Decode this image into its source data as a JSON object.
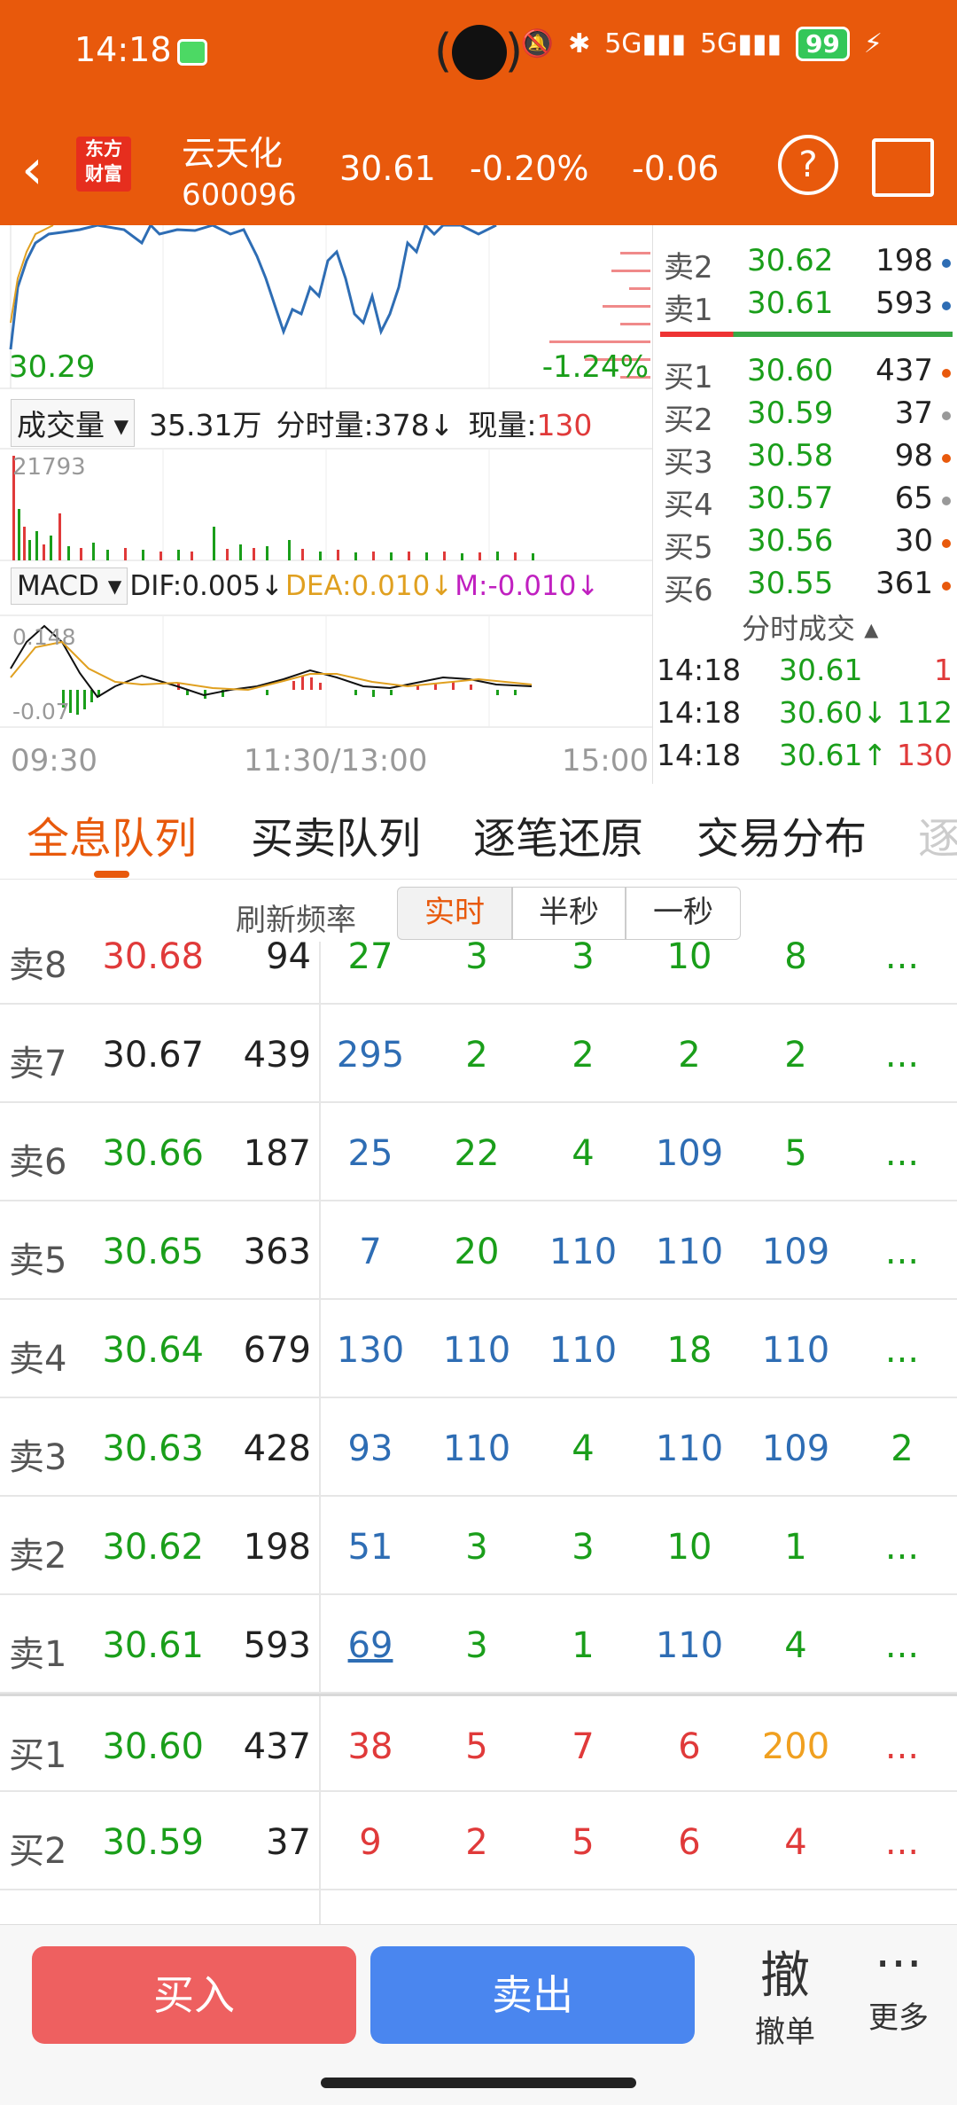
{
  "status_bar": {
    "time": "14:18",
    "signal_5g_a": "5G",
    "signal_5g_b": "5G",
    "battery": "99"
  },
  "header": {
    "back_icon": "chevron-left-icon",
    "logo_text": "东方财富",
    "stock_name": "云天化",
    "stock_code": "600096",
    "price": "30.61",
    "change_pct": "-0.20%",
    "change": "-0.06",
    "help_icon": "question-icon"
  },
  "chart": {
    "low_price": "30.29",
    "low_pct": "-1.24%",
    "volume_selector": "成交量",
    "volume_total": "35.31万",
    "volume_per_min": "分时量:378↓",
    "current_volume_label": "现量:",
    "current_volume": "130",
    "volume_max": "21793",
    "macd_selector": "MACD",
    "dif": "DIF:0.005↓",
    "dea": "DEA:0.010↓",
    "m": "M:-0.010↓",
    "macd_top": "0.148",
    "macd_bottom": "-0.07",
    "time_start": "09:30",
    "time_mid": "11:30/13:00",
    "time_end": "15:00"
  },
  "order_book": {
    "asks": [
      {
        "label": "卖2",
        "price": "30.62",
        "qty": "198",
        "dot": "#2e6db4"
      },
      {
        "label": "卖1",
        "price": "30.61",
        "qty": "593",
        "dot": "#2e6db4"
      }
    ],
    "bids": [
      {
        "label": "买1",
        "price": "30.60",
        "qty": "437",
        "dot": "#e8590c"
      },
      {
        "label": "买2",
        "price": "30.59",
        "qty": "37",
        "dot": "#999999"
      },
      {
        "label": "买3",
        "price": "30.58",
        "qty": "98",
        "dot": "#e8590c"
      },
      {
        "label": "买4",
        "price": "30.57",
        "qty": "65",
        "dot": "#999999"
      },
      {
        "label": "买5",
        "price": "30.56",
        "qty": "30",
        "dot": "#e8590c"
      },
      {
        "label": "买6",
        "price": "30.55",
        "qty": "361",
        "dot": "#e8590c"
      }
    ],
    "trades_title": "分时成交",
    "trades": [
      {
        "time": "14:18",
        "price": "30.61",
        "vol": "1",
        "color": "#e03a3a"
      },
      {
        "time": "14:18",
        "price": "30.60↓",
        "vol": "112",
        "color": "#1a9e1a"
      },
      {
        "time": "14:18",
        "price": "30.61↑",
        "vol": "130",
        "color": "#e03a3a"
      }
    ]
  },
  "tabs": [
    {
      "label": "全息队列",
      "active": true
    },
    {
      "label": "买卖队列",
      "active": false
    },
    {
      "label": "逐笔还原",
      "active": false
    },
    {
      "label": "交易分布",
      "active": false
    },
    {
      "label": "逐",
      "active": false
    }
  ],
  "refresh": {
    "label": "刷新频率",
    "options": [
      "实时",
      "半秒",
      "一秒"
    ],
    "selected": "实时"
  },
  "queue": {
    "rows": [
      {
        "label": "卖8",
        "price": "30.68",
        "price_color": "red",
        "qty": "94",
        "cells": [
          [
            "27",
            "green"
          ],
          [
            "3",
            "green"
          ],
          [
            "3",
            "green"
          ],
          [
            "10",
            "green"
          ],
          [
            "8",
            "green"
          ],
          [
            "...",
            "green"
          ]
        ]
      },
      {
        "label": "卖7",
        "price": "30.67",
        "price_color": "black",
        "qty": "439",
        "cells": [
          [
            "295",
            "blue"
          ],
          [
            "2",
            "green"
          ],
          [
            "2",
            "green"
          ],
          [
            "2",
            "green"
          ],
          [
            "2",
            "green"
          ],
          [
            "...",
            "green"
          ]
        ]
      },
      {
        "label": "卖6",
        "price": "30.66",
        "price_color": "green",
        "qty": "187",
        "cells": [
          [
            "25",
            "blue"
          ],
          [
            "22",
            "green"
          ],
          [
            "4",
            "green"
          ],
          [
            "109",
            "blue"
          ],
          [
            "5",
            "green"
          ],
          [
            "...",
            "green"
          ]
        ]
      },
      {
        "label": "卖5",
        "price": "30.65",
        "price_color": "green",
        "qty": "363",
        "cells": [
          [
            "7",
            "blue"
          ],
          [
            "20",
            "green"
          ],
          [
            "110",
            "blue"
          ],
          [
            "110",
            "blue"
          ],
          [
            "109",
            "blue"
          ],
          [
            "...",
            "green"
          ]
        ]
      },
      {
        "label": "卖4",
        "price": "30.64",
        "price_color": "green",
        "qty": "679",
        "cells": [
          [
            "130",
            "blue"
          ],
          [
            "110",
            "blue"
          ],
          [
            "110",
            "blue"
          ],
          [
            "18",
            "green"
          ],
          [
            "110",
            "blue"
          ],
          [
            "...",
            "green"
          ]
        ]
      },
      {
        "label": "卖3",
        "price": "30.63",
        "price_color": "green",
        "qty": "428",
        "cells": [
          [
            "93",
            "blue"
          ],
          [
            "110",
            "blue"
          ],
          [
            "4",
            "green"
          ],
          [
            "110",
            "blue"
          ],
          [
            "109",
            "blue"
          ],
          [
            "2",
            "green"
          ]
        ]
      },
      {
        "label": "卖2",
        "price": "30.62",
        "price_color": "green",
        "qty": "198",
        "cells": [
          [
            "51",
            "blue"
          ],
          [
            "3",
            "green"
          ],
          [
            "3",
            "green"
          ],
          [
            "10",
            "green"
          ],
          [
            "1",
            "green"
          ],
          [
            "...",
            "green"
          ]
        ]
      },
      {
        "label": "卖1",
        "price": "30.61",
        "price_color": "green",
        "qty": "593",
        "cells": [
          [
            "69",
            "blue under"
          ],
          [
            "3",
            "green"
          ],
          [
            "1",
            "green"
          ],
          [
            "110",
            "blue"
          ],
          [
            "4",
            "green"
          ],
          [
            "...",
            "green"
          ]
        ]
      },
      {
        "label": "买1",
        "price": "30.60",
        "price_color": "green",
        "qty": "437",
        "cells": [
          [
            "38",
            "red"
          ],
          [
            "5",
            "red"
          ],
          [
            "7",
            "red"
          ],
          [
            "6",
            "red"
          ],
          [
            "200",
            "orange"
          ],
          [
            "...",
            "red"
          ]
        ]
      },
      {
        "label": "买2",
        "price": "30.59",
        "price_color": "green",
        "qty": "37",
        "cells": [
          [
            "9",
            "red"
          ],
          [
            "2",
            "red"
          ],
          [
            "5",
            "red"
          ],
          [
            "6",
            "red"
          ],
          [
            "4",
            "red"
          ],
          [
            "...",
            "red"
          ]
        ]
      }
    ]
  },
  "bottom_bar": {
    "buy": "买入",
    "sell": "卖出",
    "cancel_icon_char": "撤",
    "cancel": "撤单",
    "more": "更多"
  }
}
